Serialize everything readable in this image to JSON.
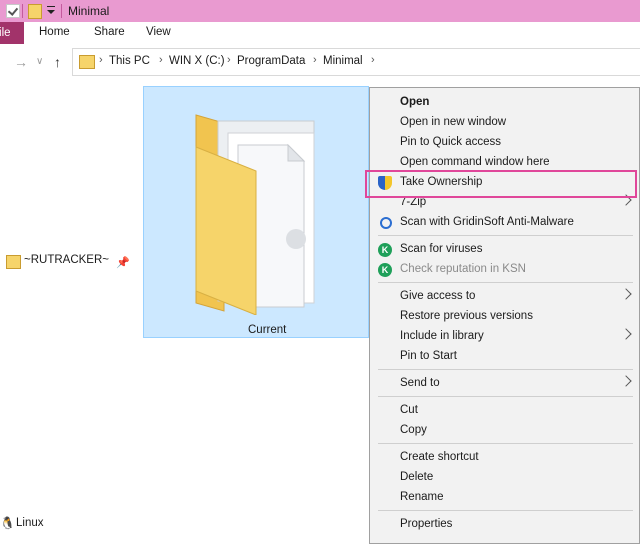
{
  "window": {
    "title": "Minimal"
  },
  "ribbon": {
    "file_label": "File",
    "tabs": [
      "Home",
      "Share",
      "View"
    ]
  },
  "address": {
    "crumbs": [
      "This PC",
      "WIN X (C:)",
      "ProgramData",
      "Minimal"
    ]
  },
  "nav_pane": {
    "items": [
      {
        "label": "~RUTRACKER~",
        "pinned": true
      },
      {
        "label": "Linux"
      }
    ]
  },
  "files": [
    {
      "name": "Current",
      "selected": true
    }
  ],
  "context_menu": {
    "highlighted": "Take Ownership",
    "items": [
      {
        "label": "Open",
        "bold": true
      },
      {
        "label": "Open in new window"
      },
      {
        "label": "Pin to Quick access"
      },
      {
        "label": "Open command window here"
      },
      {
        "label": "Take Ownership",
        "icon": "uac-shield-icon"
      },
      {
        "label": "7-Zip",
        "submenu": true
      },
      {
        "label": "Scan with GridinSoft Anti-Malware",
        "icon": "gridinsoft-icon"
      },
      {
        "label": "Scan for viruses",
        "icon": "kaspersky-icon"
      },
      {
        "label": "Check reputation in KSN",
        "icon": "kaspersky-icon",
        "disabled": true
      },
      {
        "label": "Give access to",
        "submenu": true
      },
      {
        "label": "Restore previous versions"
      },
      {
        "label": "Include in library",
        "submenu": true
      },
      {
        "label": "Pin to Start"
      },
      {
        "label": "Send to",
        "submenu": true
      },
      {
        "label": "Cut"
      },
      {
        "label": "Copy"
      },
      {
        "label": "Create shortcut"
      },
      {
        "label": "Delete"
      },
      {
        "label": "Rename"
      },
      {
        "label": "Properties"
      }
    ]
  },
  "colors": {
    "titlebar": "#e99ad0",
    "file_tab": "#a2336a",
    "selection": "#cce8ff",
    "highlight_box": "#e0479a"
  }
}
